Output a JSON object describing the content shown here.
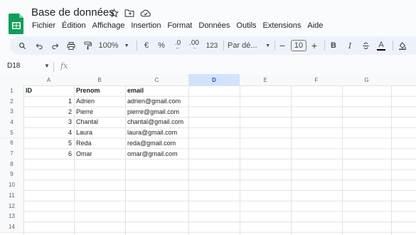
{
  "app": {
    "title": "Base de données",
    "menu": [
      "Fichier",
      "Édition",
      "Affichage",
      "Insertion",
      "Format",
      "Données",
      "Outils",
      "Extensions",
      "Aide"
    ]
  },
  "toolbar": {
    "zoom": "100%",
    "currency": "€",
    "percent": "%",
    "dec_decrease": ".0",
    "dec_increase": ".00",
    "number_format": "123",
    "font": "Par dé...",
    "font_size": "10",
    "minus": "−",
    "plus": "+",
    "bold": "B",
    "italic": "I",
    "text_color": "A"
  },
  "formula_bar": {
    "name_box": "D18",
    "fx": "fx"
  },
  "sheet": {
    "columns": [
      "A",
      "B",
      "C",
      "D",
      "E",
      "F",
      "G"
    ],
    "rows": [
      "1",
      "2",
      "3",
      "4",
      "5",
      "6",
      "7",
      "8",
      "9",
      "10",
      "11",
      "12",
      "13",
      "14"
    ],
    "selected_column": "D",
    "data": [
      [
        "ID",
        "Prenom",
        "email"
      ],
      [
        "1",
        "Adrien",
        "adrien@gmail.com"
      ],
      [
        "2",
        "Pierre",
        "pierre@gmail.com"
      ],
      [
        "3",
        "Chantal",
        "chantal@gmail.com"
      ],
      [
        "4",
        "Laura",
        "laura@gmail.com"
      ],
      [
        "5",
        "Reda",
        "reda@gmail.com"
      ],
      [
        "6",
        "Omar",
        "omar@gmail.com"
      ]
    ]
  },
  "colors": {
    "accent": "#0b57d0",
    "logo_green": "#0f9d58",
    "selected_header": "#d3e3fd",
    "grid_line": "#e1e3e1"
  }
}
